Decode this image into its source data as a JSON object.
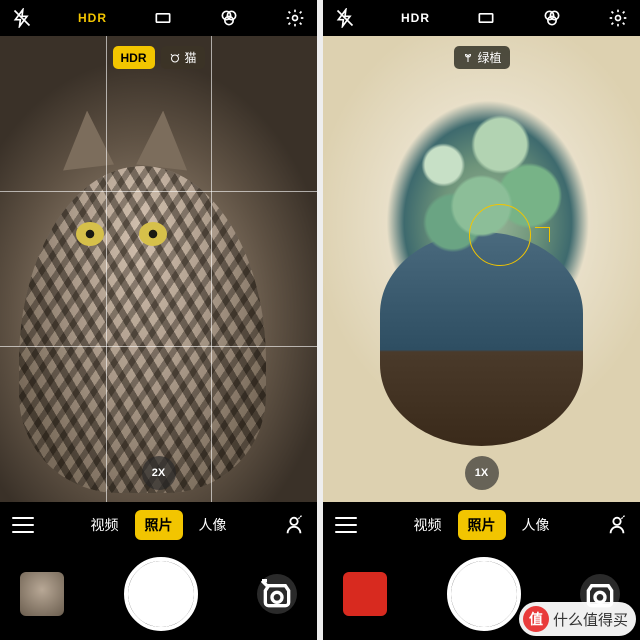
{
  "left": {
    "top": {
      "hdr": "HDR"
    },
    "tags": {
      "hdr": "HDR",
      "subject": "猫"
    },
    "zoom": "2X",
    "modes": {
      "video": "视频",
      "photo": "照片",
      "portrait": "人像"
    }
  },
  "right": {
    "top": {
      "hdr": "HDR"
    },
    "tags": {
      "subject": "绿植"
    },
    "zoom": "1X",
    "modes": {
      "video": "视频",
      "photo": "照片",
      "portrait": "人像"
    }
  },
  "watermark": {
    "badge": "值",
    "text": "什么值得买"
  }
}
